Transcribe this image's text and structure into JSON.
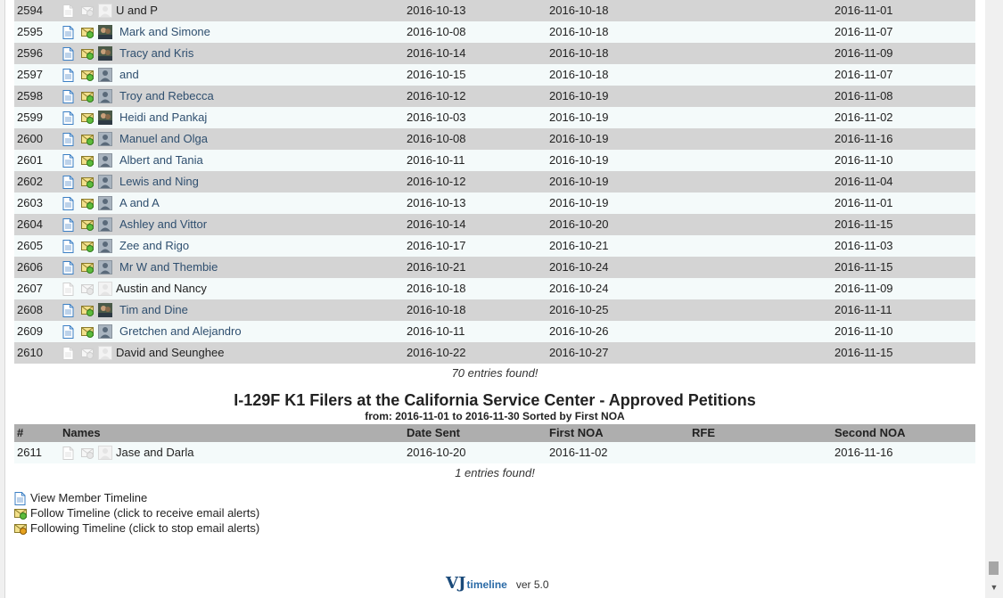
{
  "rows": [
    {
      "num": "2594",
      "name": "U and P",
      "sent": "2016-10-13",
      "noa1": "2016-10-18",
      "rfe": "",
      "noa2": "2016-11-01",
      "linked": false,
      "avatar": "blank"
    },
    {
      "num": "2595",
      "name": "Mark and Simone",
      "sent": "2016-10-08",
      "noa1": "2016-10-18",
      "rfe": "",
      "noa2": "2016-11-07",
      "linked": true,
      "avatar": "photo"
    },
    {
      "num": "2596",
      "name": "Tracy and Kris",
      "sent": "2016-10-14",
      "noa1": "2016-10-18",
      "rfe": "",
      "noa2": "2016-11-09",
      "linked": true,
      "avatar": "photo"
    },
    {
      "num": "2597",
      "name": "and",
      "sent": "2016-10-15",
      "noa1": "2016-10-18",
      "rfe": "",
      "noa2": "2016-11-07",
      "linked": true,
      "avatar": "default"
    },
    {
      "num": "2598",
      "name": "Troy and Rebecca",
      "sent": "2016-10-12",
      "noa1": "2016-10-19",
      "rfe": "",
      "noa2": "2016-11-08",
      "linked": true,
      "avatar": "default"
    },
    {
      "num": "2599",
      "name": "Heidi and Pankaj",
      "sent": "2016-10-03",
      "noa1": "2016-10-19",
      "rfe": "",
      "noa2": "2016-11-02",
      "linked": true,
      "avatar": "photo"
    },
    {
      "num": "2600",
      "name": "Manuel and Olga",
      "sent": "2016-10-08",
      "noa1": "2016-10-19",
      "rfe": "",
      "noa2": "2016-11-16",
      "linked": true,
      "avatar": "default"
    },
    {
      "num": "2601",
      "name": "Albert and Tania",
      "sent": "2016-10-11",
      "noa1": "2016-10-19",
      "rfe": "",
      "noa2": "2016-11-10",
      "linked": true,
      "avatar": "default"
    },
    {
      "num": "2602",
      "name": "Lewis and Ning",
      "sent": "2016-10-12",
      "noa1": "2016-10-19",
      "rfe": "",
      "noa2": "2016-11-04",
      "linked": true,
      "avatar": "default"
    },
    {
      "num": "2603",
      "name": "A and A",
      "sent": "2016-10-13",
      "noa1": "2016-10-19",
      "rfe": "",
      "noa2": "2016-11-01",
      "linked": true,
      "avatar": "default"
    },
    {
      "num": "2604",
      "name": "Ashley and Vittor",
      "sent": "2016-10-14",
      "noa1": "2016-10-20",
      "rfe": "",
      "noa2": "2016-11-15",
      "linked": true,
      "avatar": "default"
    },
    {
      "num": "2605",
      "name": "Zee and Rigo",
      "sent": "2016-10-17",
      "noa1": "2016-10-21",
      "rfe": "",
      "noa2": "2016-11-03",
      "linked": true,
      "avatar": "default"
    },
    {
      "num": "2606",
      "name": "Mr W and Thembie",
      "sent": "2016-10-21",
      "noa1": "2016-10-24",
      "rfe": "",
      "noa2": "2016-11-15",
      "linked": true,
      "avatar": "default"
    },
    {
      "num": "2607",
      "name": "Austin and Nancy",
      "sent": "2016-10-18",
      "noa1": "2016-10-24",
      "rfe": "",
      "noa2": "2016-11-09",
      "linked": false,
      "avatar": "blank"
    },
    {
      "num": "2608",
      "name": "Tim and Dine",
      "sent": "2016-10-18",
      "noa1": "2016-10-25",
      "rfe": "",
      "noa2": "2016-11-11",
      "linked": true,
      "avatar": "photo"
    },
    {
      "num": "2609",
      "name": "Gretchen and Alejandro",
      "sent": "2016-10-11",
      "noa1": "2016-10-26",
      "rfe": "",
      "noa2": "2016-11-10",
      "linked": true,
      "avatar": "default"
    },
    {
      "num": "2610",
      "name": "David and Seunghee",
      "sent": "2016-10-22",
      "noa1": "2016-10-27",
      "rfe": "",
      "noa2": "2016-11-15",
      "linked": false,
      "avatar": "blank"
    }
  ],
  "first_section": {
    "found_text": "70 entries found!"
  },
  "second_section": {
    "title": "I-129F K1 Filers at the California Service Center - Approved Petitions",
    "subtitle": "from: 2016-11-01 to 2016-11-30 Sorted by First NOA",
    "headers": {
      "num": "#",
      "names": "Names",
      "sent": "Date Sent",
      "noa1": "First NOA",
      "rfe": "RFE",
      "noa2": "Second NOA"
    },
    "rows": [
      {
        "num": "2611",
        "name": "Jase and Darla",
        "sent": "2016-10-20",
        "noa1": "2016-11-02",
        "rfe": "",
        "noa2": "2016-11-16",
        "linked": false,
        "avatar": "blank"
      }
    ],
    "found_text": "1 entries found!"
  },
  "legend": {
    "view": "View Member Timeline",
    "follow": "Follow Timeline (click to receive email alerts)",
    "following": "Following Timeline (click to stop email alerts)"
  },
  "footer": {
    "logo_vj": "VJ",
    "logo_word": "timeline",
    "version": "ver 5.0"
  },
  "colors": {
    "row_alt": "#d4d4d4",
    "row_norm": "#f4fafa",
    "header": "#aeaeae",
    "link": "#2f4f6f"
  }
}
